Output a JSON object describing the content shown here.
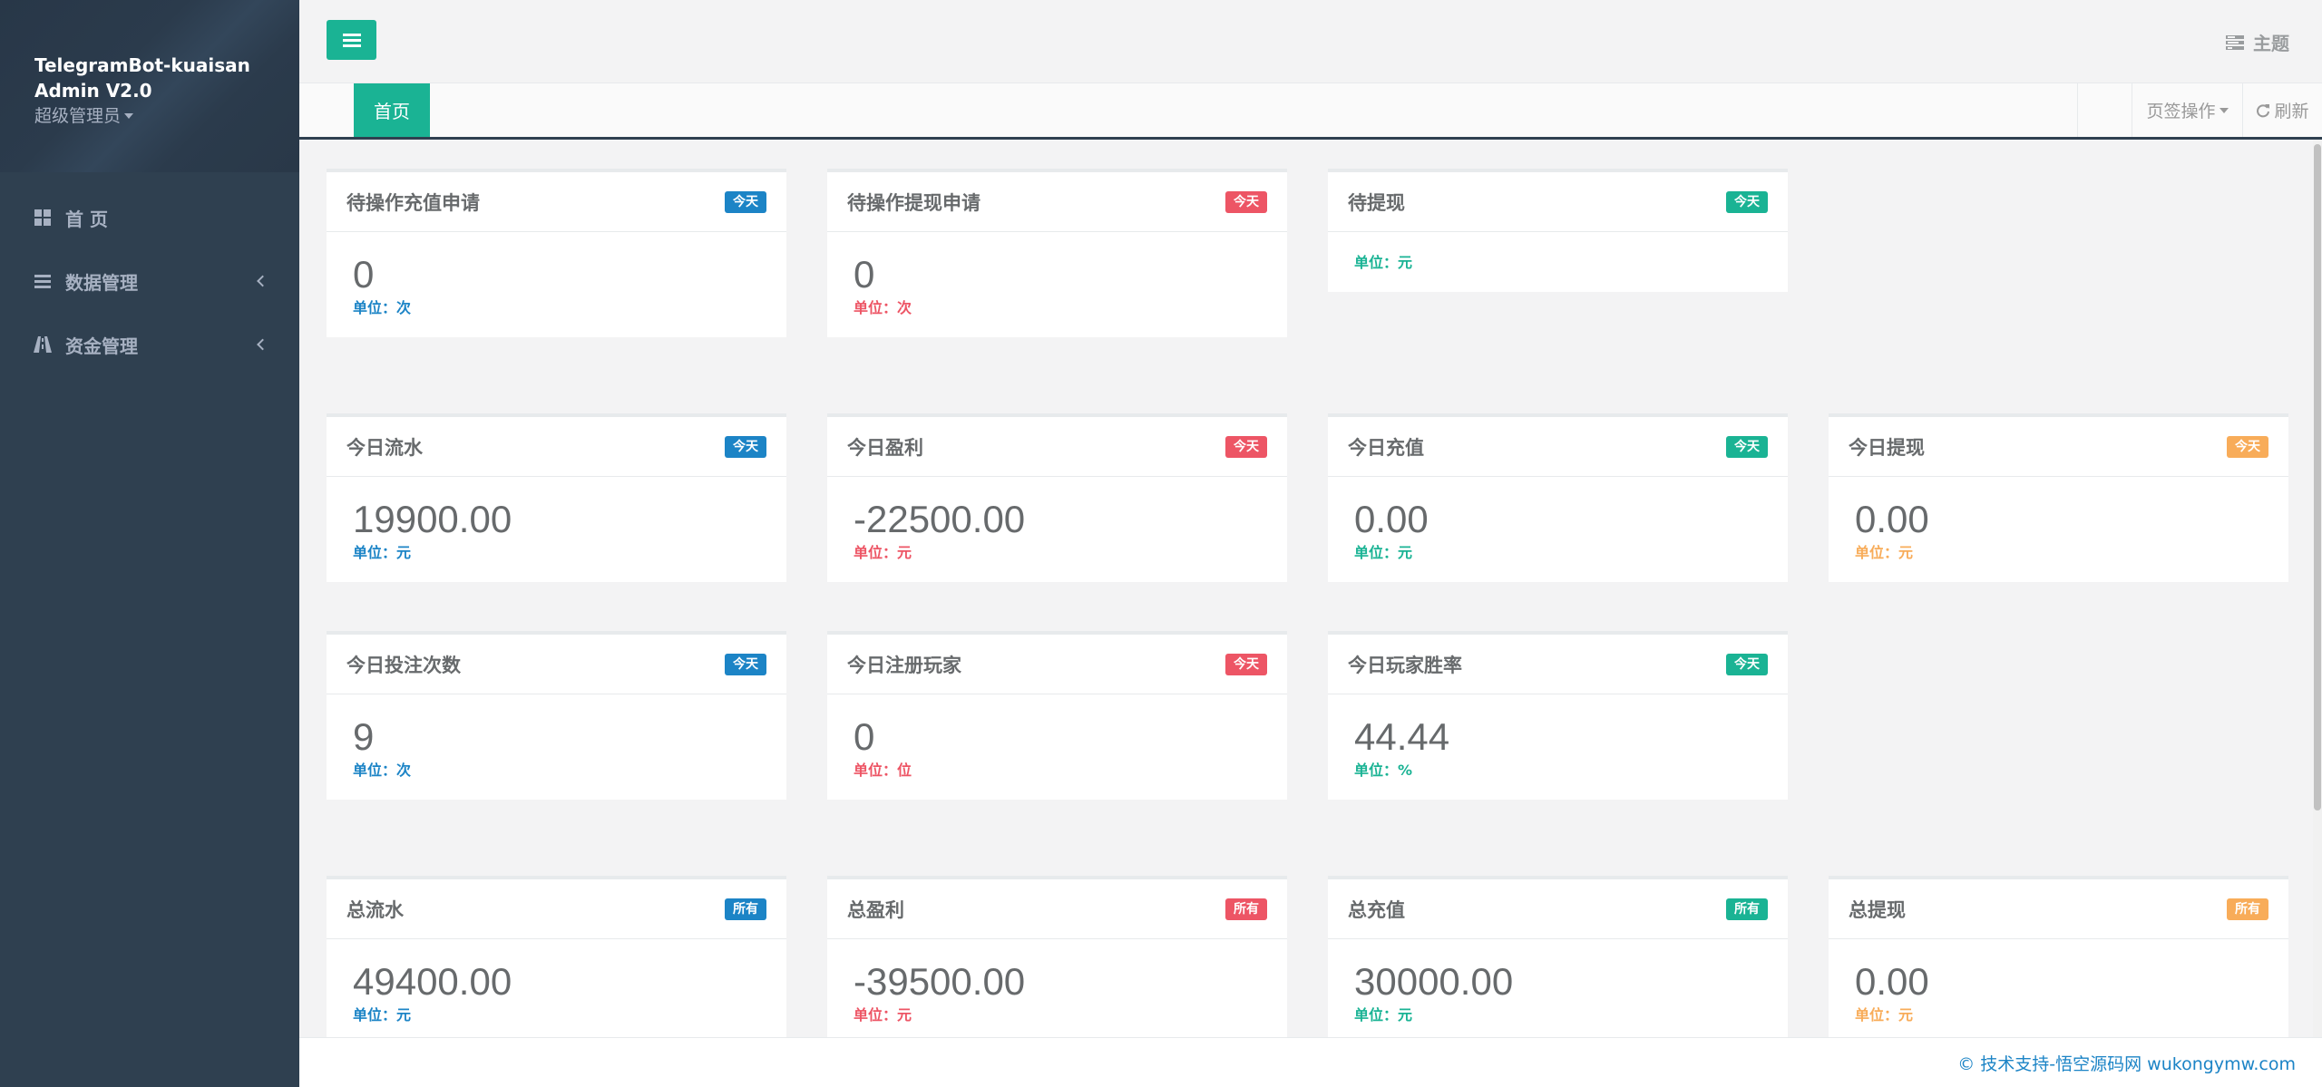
{
  "sidebar": {
    "brand_line1": "TelegramBot-kuaisan",
    "brand_line2": "Admin V2.0",
    "role": "超级管理员",
    "items": [
      {
        "label": "首 页",
        "icon": "dashboard-grid-icon"
      },
      {
        "label": "数据管理",
        "icon": "list-icon"
      },
      {
        "label": "资金管理",
        "icon": "road-icon"
      }
    ]
  },
  "topbar": {
    "menu_icon": "hamburger-icon",
    "theme_label": "主题"
  },
  "tabbar": {
    "home_tab": "首页",
    "tab_ops": "页签操作",
    "refresh": "刷新"
  },
  "colors": {
    "blue": "#1c84c6",
    "red": "#ed5565",
    "green": "#1ab394",
    "orange": "#f8ac59",
    "sidebar": "#2f4050"
  },
  "cards": {
    "pending_recharge": {
      "title": "待操作充值申请",
      "badge": "今天",
      "value": "0",
      "unit": "单位：次"
    },
    "pending_withdraw": {
      "title": "待操作提现申请",
      "badge": "今天",
      "value": "0",
      "unit": "单位：次"
    },
    "to_withdraw": {
      "title": "待提现",
      "badge": "今天",
      "value": "",
      "unit": "单位：元"
    },
    "today_flow": {
      "title": "今日流水",
      "badge": "今天",
      "value": "19900.00",
      "unit": "单位：元"
    },
    "today_profit": {
      "title": "今日盈利",
      "badge": "今天",
      "value": "-22500.00",
      "unit": "单位：元"
    },
    "today_recharge": {
      "title": "今日充值",
      "badge": "今天",
      "value": "0.00",
      "unit": "单位：元"
    },
    "today_withdraw": {
      "title": "今日提现",
      "badge": "今天",
      "value": "0.00",
      "unit": "单位：元"
    },
    "today_bets": {
      "title": "今日投注次数",
      "badge": "今天",
      "value": "9",
      "unit": "单位：次"
    },
    "today_register": {
      "title": "今日注册玩家",
      "badge": "今天",
      "value": "0",
      "unit": "单位：位"
    },
    "today_winrate": {
      "title": "今日玩家胜率",
      "badge": "今天",
      "value": "44.44",
      "unit": "单位：%"
    },
    "total_flow": {
      "title": "总流水",
      "badge": "所有",
      "value": "49400.00",
      "unit": "单位：元"
    },
    "total_profit": {
      "title": "总盈利",
      "badge": "所有",
      "value": "-39500.00",
      "unit": "单位：元"
    },
    "total_recharge": {
      "title": "总充值",
      "badge": "所有",
      "value": "30000.00",
      "unit": "单位：元"
    },
    "total_withdraw": {
      "title": "总提现",
      "badge": "所有",
      "value": "0.00",
      "unit": "单位：元"
    }
  },
  "footer": {
    "text": "© 技术支持-悟空源码网 wukongymw.com"
  }
}
